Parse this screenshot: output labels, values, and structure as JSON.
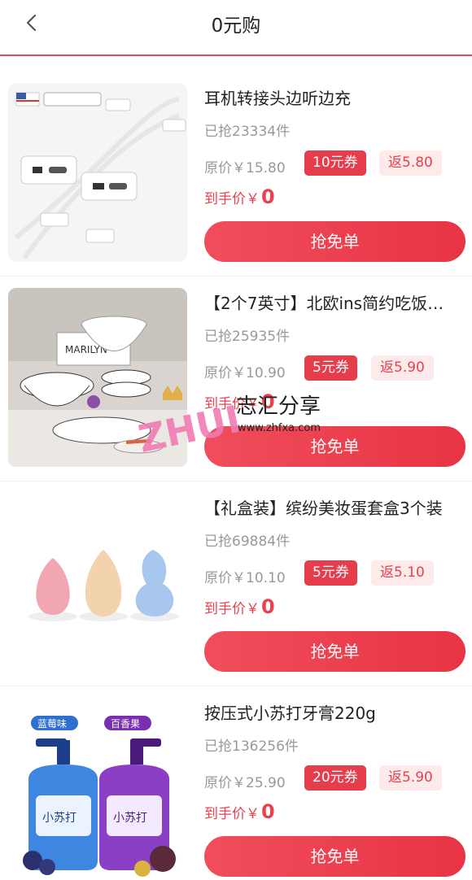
{
  "header": {
    "title": "0元购"
  },
  "products": [
    {
      "title": "耳机转接头边听边充",
      "sold": "已抢23334件",
      "original_price": "原价￥15.80",
      "coupon": "10元券",
      "rebate": "返5.80",
      "final_label": "到手价￥",
      "final_price": "0",
      "buy_label": "抢免单"
    },
    {
      "title": "【2个7英寸】北欧ins简约吃饭…",
      "sold": "已抢25935件",
      "original_price": "原价￥10.90",
      "coupon": "5元券",
      "rebate": "返5.90",
      "final_label": "到手价￥",
      "final_price": "0",
      "buy_label": "抢免单"
    },
    {
      "title": "【礼盒装】缤纷美妆蛋套盒3个装",
      "sold": "已抢69884件",
      "original_price": "原价￥10.10",
      "coupon": "5元券",
      "rebate": "返5.10",
      "final_label": "到手价￥",
      "final_price": "0",
      "buy_label": "抢免单"
    },
    {
      "title": "按压式小苏打牙膏220g",
      "sold": "已抢136256件",
      "original_price": "原价￥25.90",
      "coupon": "20元券",
      "rebate": "返5.90",
      "final_label": "到手价￥",
      "final_price": "0",
      "buy_label": "抢免单"
    }
  ],
  "image_text": {
    "dish_box": "MARILYN",
    "toothpaste_blue_tag": "蓝莓味",
    "toothpaste_purple_tag": "百香果",
    "toothpaste_blue_label": "小苏打",
    "toothpaste_purple_label": "小苏打"
  },
  "watermark": {
    "text": "志汇分享",
    "brand": "ZHUI",
    "url": "www.zhfxa.com"
  },
  "colors": {
    "accent": "#e8424f",
    "button": "#e83444",
    "rebate_bg": "#fdeaea"
  }
}
